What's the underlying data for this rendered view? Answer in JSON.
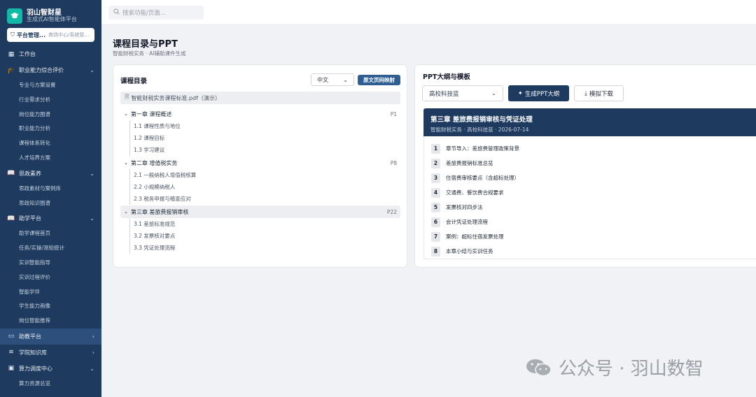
{
  "brand": {
    "name": "羽山智财星",
    "subtitle": "生成式AI智能体平台"
  },
  "role": {
    "main": "平台管理...",
    "sub": "商场中心/系统管..."
  },
  "search": {
    "placeholder": "搜索功能/页面..."
  },
  "nav": {
    "workbench": "工作台",
    "group1": {
      "label": "职业能力综合评价",
      "items": [
        "专业与方案设置",
        "行业需求分析",
        "岗位能力图谱",
        "职业能力分析",
        "课程体系转化",
        "人才培养方案"
      ]
    },
    "group2": {
      "label": "思政素养",
      "items": [
        "思政素材与案例库",
        "思政知识图谱"
      ]
    },
    "group3": {
      "label": "助学平台",
      "items": [
        "助学课程首页",
        "任务/实操/测验统计",
        "实训智能指导",
        "实训过程评价",
        "智能学伴",
        "学生能力画像",
        "岗位智能推荐"
      ]
    },
    "group4": {
      "label": "助教平台"
    },
    "group5": {
      "label": "学院知识库"
    },
    "group6": {
      "label": "算力调度中心",
      "items": [
        "算力资源总览"
      ]
    }
  },
  "page": {
    "title": "课程目录与PPT",
    "subtitle": "智能财税实务 · AI辅助课件生成"
  },
  "catalog": {
    "title": "课程目录",
    "lang": "中文",
    "map_button": "原文页码映射",
    "file": "智能财税实务课程标准.pdf（演示）",
    "chapters": [
      {
        "title": "第一章 课程概述",
        "page": "P1",
        "sections": [
          "1.1 课程性质与地位",
          "1.2 课程目标",
          "1.3 学习建议"
        ]
      },
      {
        "title": "第二章 增值税实务",
        "page": "P8",
        "sections": [
          "2.1 一般纳税人增值税核算",
          "2.2 小规模纳税人",
          "2.3 税务申报与稽查应对"
        ]
      },
      {
        "title": "第三章 差旅费报销审核",
        "page": "P22",
        "sections": [
          "3.1 差旅标准规范",
          "3.2 发票核对要点",
          "3.3 凭证处理流程"
        ]
      }
    ]
  },
  "ppt": {
    "title": "PPT大纲与模板",
    "template": "高校科技蓝",
    "generate_button": "生成PPT大纲",
    "download_button": "模拟下载",
    "slide_title": "第三章 差旅费报销审核与凭证处理",
    "slide_sub": "智能财税实务 · 高校科技蓝 · 2026-07-14",
    "outline": [
      {
        "num": "1",
        "text": "章节导入：差旅费管理政策背景"
      },
      {
        "num": "2",
        "text": "差旅费报销标准总览"
      },
      {
        "num": "3",
        "text": "住宿费审核要点（含超标处理）"
      },
      {
        "num": "4",
        "text": "交通费、餐饮费合规要求"
      },
      {
        "num": "5",
        "text": "发票核对四步法"
      },
      {
        "num": "6",
        "text": "会计凭证处理流程"
      },
      {
        "num": "7",
        "text": "案例：超标住宿发票处理"
      },
      {
        "num": "8",
        "text": "本章小结与实训任务"
      }
    ]
  },
  "watermark": {
    "text": "公众号 · 羽山数智"
  },
  "icons": {
    "logo": "graduation-cap-icon",
    "search": "search-icon",
    "grid": "grid-icon",
    "book": "book-icon",
    "chevron": "chevron-icon",
    "sparkle": "sparkle-icon",
    "download": "download-icon",
    "file": "file-icon"
  },
  "colors": {
    "sidebar": "#1e3a5f",
    "accent": "#2f5e92",
    "brand_logo": "#14b8a6"
  }
}
